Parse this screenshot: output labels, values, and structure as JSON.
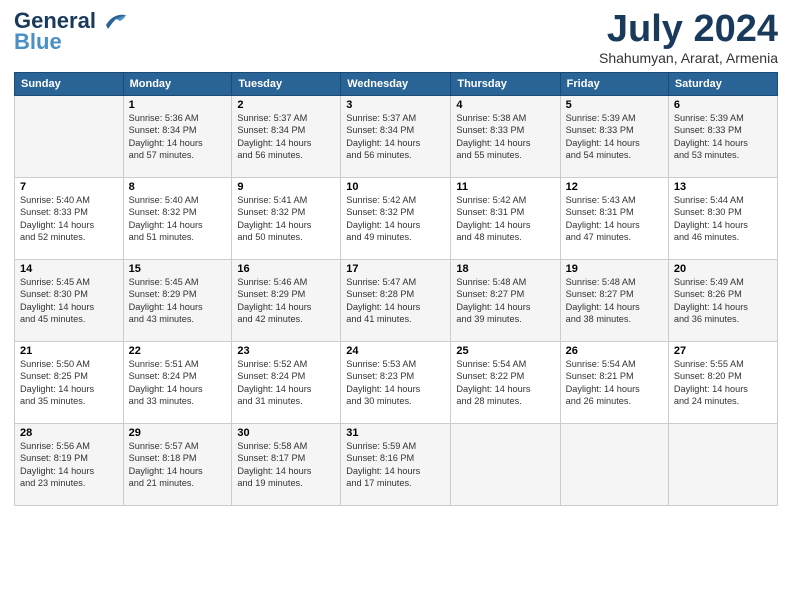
{
  "header": {
    "logo_general": "General",
    "logo_blue": "Blue",
    "month": "July 2024",
    "location": "Shahumyan, Ararat, Armenia"
  },
  "weekdays": [
    "Sunday",
    "Monday",
    "Tuesday",
    "Wednesday",
    "Thursday",
    "Friday",
    "Saturday"
  ],
  "weeks": [
    [
      {
        "day": "",
        "info": ""
      },
      {
        "day": "1",
        "info": "Sunrise: 5:36 AM\nSunset: 8:34 PM\nDaylight: 14 hours\nand 57 minutes."
      },
      {
        "day": "2",
        "info": "Sunrise: 5:37 AM\nSunset: 8:34 PM\nDaylight: 14 hours\nand 56 minutes."
      },
      {
        "day": "3",
        "info": "Sunrise: 5:37 AM\nSunset: 8:34 PM\nDaylight: 14 hours\nand 56 minutes."
      },
      {
        "day": "4",
        "info": "Sunrise: 5:38 AM\nSunset: 8:33 PM\nDaylight: 14 hours\nand 55 minutes."
      },
      {
        "day": "5",
        "info": "Sunrise: 5:39 AM\nSunset: 8:33 PM\nDaylight: 14 hours\nand 54 minutes."
      },
      {
        "day": "6",
        "info": "Sunrise: 5:39 AM\nSunset: 8:33 PM\nDaylight: 14 hours\nand 53 minutes."
      }
    ],
    [
      {
        "day": "7",
        "info": "Sunrise: 5:40 AM\nSunset: 8:33 PM\nDaylight: 14 hours\nand 52 minutes."
      },
      {
        "day": "8",
        "info": "Sunrise: 5:40 AM\nSunset: 8:32 PM\nDaylight: 14 hours\nand 51 minutes."
      },
      {
        "day": "9",
        "info": "Sunrise: 5:41 AM\nSunset: 8:32 PM\nDaylight: 14 hours\nand 50 minutes."
      },
      {
        "day": "10",
        "info": "Sunrise: 5:42 AM\nSunset: 8:32 PM\nDaylight: 14 hours\nand 49 minutes."
      },
      {
        "day": "11",
        "info": "Sunrise: 5:42 AM\nSunset: 8:31 PM\nDaylight: 14 hours\nand 48 minutes."
      },
      {
        "day": "12",
        "info": "Sunrise: 5:43 AM\nSunset: 8:31 PM\nDaylight: 14 hours\nand 47 minutes."
      },
      {
        "day": "13",
        "info": "Sunrise: 5:44 AM\nSunset: 8:30 PM\nDaylight: 14 hours\nand 46 minutes."
      }
    ],
    [
      {
        "day": "14",
        "info": "Sunrise: 5:45 AM\nSunset: 8:30 PM\nDaylight: 14 hours\nand 45 minutes."
      },
      {
        "day": "15",
        "info": "Sunrise: 5:45 AM\nSunset: 8:29 PM\nDaylight: 14 hours\nand 43 minutes."
      },
      {
        "day": "16",
        "info": "Sunrise: 5:46 AM\nSunset: 8:29 PM\nDaylight: 14 hours\nand 42 minutes."
      },
      {
        "day": "17",
        "info": "Sunrise: 5:47 AM\nSunset: 8:28 PM\nDaylight: 14 hours\nand 41 minutes."
      },
      {
        "day": "18",
        "info": "Sunrise: 5:48 AM\nSunset: 8:27 PM\nDaylight: 14 hours\nand 39 minutes."
      },
      {
        "day": "19",
        "info": "Sunrise: 5:48 AM\nSunset: 8:27 PM\nDaylight: 14 hours\nand 38 minutes."
      },
      {
        "day": "20",
        "info": "Sunrise: 5:49 AM\nSunset: 8:26 PM\nDaylight: 14 hours\nand 36 minutes."
      }
    ],
    [
      {
        "day": "21",
        "info": "Sunrise: 5:50 AM\nSunset: 8:25 PM\nDaylight: 14 hours\nand 35 minutes."
      },
      {
        "day": "22",
        "info": "Sunrise: 5:51 AM\nSunset: 8:24 PM\nDaylight: 14 hours\nand 33 minutes."
      },
      {
        "day": "23",
        "info": "Sunrise: 5:52 AM\nSunset: 8:24 PM\nDaylight: 14 hours\nand 31 minutes."
      },
      {
        "day": "24",
        "info": "Sunrise: 5:53 AM\nSunset: 8:23 PM\nDaylight: 14 hours\nand 30 minutes."
      },
      {
        "day": "25",
        "info": "Sunrise: 5:54 AM\nSunset: 8:22 PM\nDaylight: 14 hours\nand 28 minutes."
      },
      {
        "day": "26",
        "info": "Sunrise: 5:54 AM\nSunset: 8:21 PM\nDaylight: 14 hours\nand 26 minutes."
      },
      {
        "day": "27",
        "info": "Sunrise: 5:55 AM\nSunset: 8:20 PM\nDaylight: 14 hours\nand 24 minutes."
      }
    ],
    [
      {
        "day": "28",
        "info": "Sunrise: 5:56 AM\nSunset: 8:19 PM\nDaylight: 14 hours\nand 23 minutes."
      },
      {
        "day": "29",
        "info": "Sunrise: 5:57 AM\nSunset: 8:18 PM\nDaylight: 14 hours\nand 21 minutes."
      },
      {
        "day": "30",
        "info": "Sunrise: 5:58 AM\nSunset: 8:17 PM\nDaylight: 14 hours\nand 19 minutes."
      },
      {
        "day": "31",
        "info": "Sunrise: 5:59 AM\nSunset: 8:16 PM\nDaylight: 14 hours\nand 17 minutes."
      },
      {
        "day": "",
        "info": ""
      },
      {
        "day": "",
        "info": ""
      },
      {
        "day": "",
        "info": ""
      }
    ]
  ]
}
